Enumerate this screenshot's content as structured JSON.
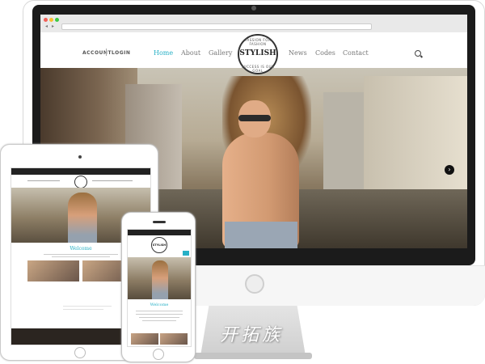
{
  "desktop": {
    "url_text": "",
    "header": {
      "account_label": "ACCOUNT",
      "login_label": "LOGIN",
      "nav": [
        "Home",
        "About",
        "Gallery",
        "News",
        "Codes",
        "Contact"
      ],
      "active_nav": "Home"
    },
    "logo": {
      "text": "STYLISH",
      "ring_top": "PASSION FOR FASHION",
      "ring_bottom": "SUCCESS IS OUR GOAL"
    },
    "hero_arrow": "›"
  },
  "tablet": {
    "welcome_title": "Welcome"
  },
  "phone": {
    "logo_text": "STYLISH",
    "welcome_title": "Welcome"
  },
  "watermark": "开拓族",
  "colors": {
    "accent": "#27b0c6",
    "bezel": "#1b1b1b"
  }
}
